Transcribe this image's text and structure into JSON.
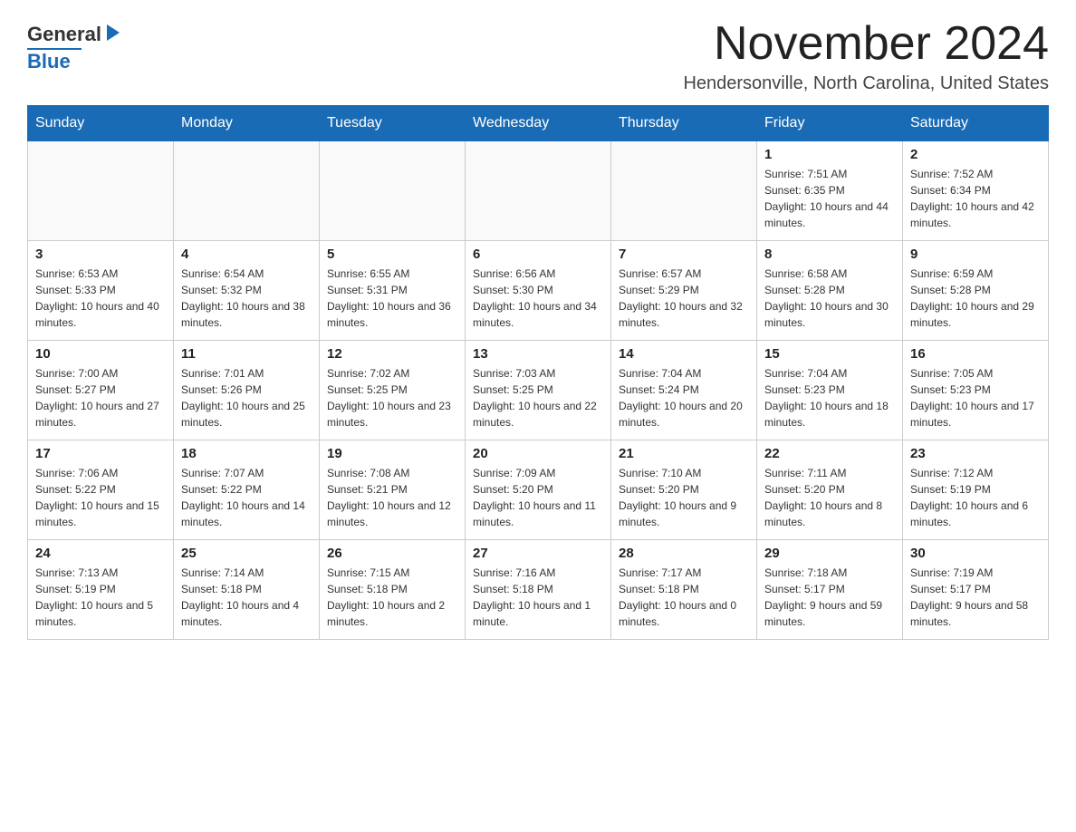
{
  "header": {
    "logo_general": "General",
    "logo_blue": "Blue",
    "month_title": "November 2024",
    "location": "Hendersonville, North Carolina, United States"
  },
  "days_of_week": [
    "Sunday",
    "Monday",
    "Tuesday",
    "Wednesday",
    "Thursday",
    "Friday",
    "Saturday"
  ],
  "weeks": [
    [
      {
        "day": "",
        "info": ""
      },
      {
        "day": "",
        "info": ""
      },
      {
        "day": "",
        "info": ""
      },
      {
        "day": "",
        "info": ""
      },
      {
        "day": "",
        "info": ""
      },
      {
        "day": "1",
        "info": "Sunrise: 7:51 AM\nSunset: 6:35 PM\nDaylight: 10 hours and 44 minutes."
      },
      {
        "day": "2",
        "info": "Sunrise: 7:52 AM\nSunset: 6:34 PM\nDaylight: 10 hours and 42 minutes."
      }
    ],
    [
      {
        "day": "3",
        "info": "Sunrise: 6:53 AM\nSunset: 5:33 PM\nDaylight: 10 hours and 40 minutes."
      },
      {
        "day": "4",
        "info": "Sunrise: 6:54 AM\nSunset: 5:32 PM\nDaylight: 10 hours and 38 minutes."
      },
      {
        "day": "5",
        "info": "Sunrise: 6:55 AM\nSunset: 5:31 PM\nDaylight: 10 hours and 36 minutes."
      },
      {
        "day": "6",
        "info": "Sunrise: 6:56 AM\nSunset: 5:30 PM\nDaylight: 10 hours and 34 minutes."
      },
      {
        "day": "7",
        "info": "Sunrise: 6:57 AM\nSunset: 5:29 PM\nDaylight: 10 hours and 32 minutes."
      },
      {
        "day": "8",
        "info": "Sunrise: 6:58 AM\nSunset: 5:28 PM\nDaylight: 10 hours and 30 minutes."
      },
      {
        "day": "9",
        "info": "Sunrise: 6:59 AM\nSunset: 5:28 PM\nDaylight: 10 hours and 29 minutes."
      }
    ],
    [
      {
        "day": "10",
        "info": "Sunrise: 7:00 AM\nSunset: 5:27 PM\nDaylight: 10 hours and 27 minutes."
      },
      {
        "day": "11",
        "info": "Sunrise: 7:01 AM\nSunset: 5:26 PM\nDaylight: 10 hours and 25 minutes."
      },
      {
        "day": "12",
        "info": "Sunrise: 7:02 AM\nSunset: 5:25 PM\nDaylight: 10 hours and 23 minutes."
      },
      {
        "day": "13",
        "info": "Sunrise: 7:03 AM\nSunset: 5:25 PM\nDaylight: 10 hours and 22 minutes."
      },
      {
        "day": "14",
        "info": "Sunrise: 7:04 AM\nSunset: 5:24 PM\nDaylight: 10 hours and 20 minutes."
      },
      {
        "day": "15",
        "info": "Sunrise: 7:04 AM\nSunset: 5:23 PM\nDaylight: 10 hours and 18 minutes."
      },
      {
        "day": "16",
        "info": "Sunrise: 7:05 AM\nSunset: 5:23 PM\nDaylight: 10 hours and 17 minutes."
      }
    ],
    [
      {
        "day": "17",
        "info": "Sunrise: 7:06 AM\nSunset: 5:22 PM\nDaylight: 10 hours and 15 minutes."
      },
      {
        "day": "18",
        "info": "Sunrise: 7:07 AM\nSunset: 5:22 PM\nDaylight: 10 hours and 14 minutes."
      },
      {
        "day": "19",
        "info": "Sunrise: 7:08 AM\nSunset: 5:21 PM\nDaylight: 10 hours and 12 minutes."
      },
      {
        "day": "20",
        "info": "Sunrise: 7:09 AM\nSunset: 5:20 PM\nDaylight: 10 hours and 11 minutes."
      },
      {
        "day": "21",
        "info": "Sunrise: 7:10 AM\nSunset: 5:20 PM\nDaylight: 10 hours and 9 minutes."
      },
      {
        "day": "22",
        "info": "Sunrise: 7:11 AM\nSunset: 5:20 PM\nDaylight: 10 hours and 8 minutes."
      },
      {
        "day": "23",
        "info": "Sunrise: 7:12 AM\nSunset: 5:19 PM\nDaylight: 10 hours and 6 minutes."
      }
    ],
    [
      {
        "day": "24",
        "info": "Sunrise: 7:13 AM\nSunset: 5:19 PM\nDaylight: 10 hours and 5 minutes."
      },
      {
        "day": "25",
        "info": "Sunrise: 7:14 AM\nSunset: 5:18 PM\nDaylight: 10 hours and 4 minutes."
      },
      {
        "day": "26",
        "info": "Sunrise: 7:15 AM\nSunset: 5:18 PM\nDaylight: 10 hours and 2 minutes."
      },
      {
        "day": "27",
        "info": "Sunrise: 7:16 AM\nSunset: 5:18 PM\nDaylight: 10 hours and 1 minute."
      },
      {
        "day": "28",
        "info": "Sunrise: 7:17 AM\nSunset: 5:18 PM\nDaylight: 10 hours and 0 minutes."
      },
      {
        "day": "29",
        "info": "Sunrise: 7:18 AM\nSunset: 5:17 PM\nDaylight: 9 hours and 59 minutes."
      },
      {
        "day": "30",
        "info": "Sunrise: 7:19 AM\nSunset: 5:17 PM\nDaylight: 9 hours and 58 minutes."
      }
    ]
  ]
}
